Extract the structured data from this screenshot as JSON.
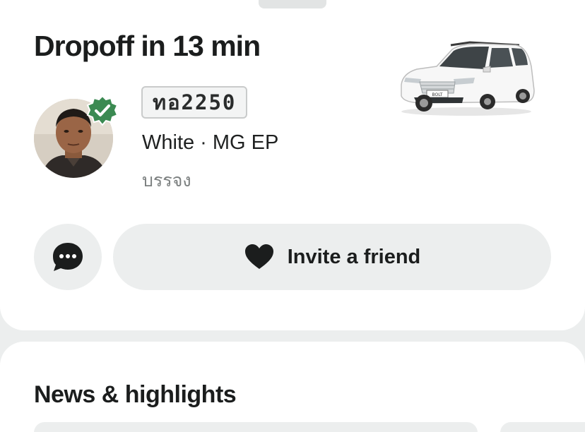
{
  "trip": {
    "status_title": "Dropoff in 13 min"
  },
  "driver": {
    "plate": "ทอ2250",
    "vehicle": "White · MG EP",
    "name": "บรรจง"
  },
  "actions": {
    "invite_label": "Invite a friend",
    "chat_icon": "chat-bubble-icon",
    "invite_icon": "heart-icon"
  },
  "news": {
    "title": "News & highlights"
  },
  "colors": {
    "verified_badge": "#3b8a52",
    "button_bg": "#eceeee",
    "text_primary": "#1b1d1d",
    "text_secondary": "#7c8080"
  }
}
